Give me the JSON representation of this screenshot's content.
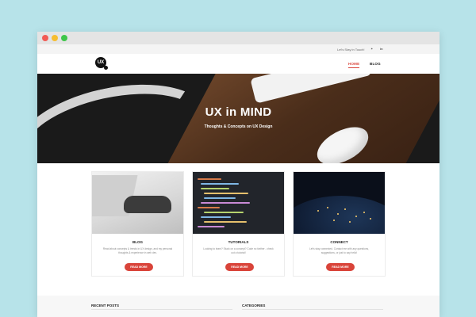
{
  "topbar": {
    "stay_text": "Let's Stay in Touch!",
    "twitter_icon": "twitter-icon",
    "linkedin_icon": "linkedin-icon"
  },
  "header": {
    "logo_text": "UX",
    "nav": [
      {
        "label": "HOME",
        "active": true
      },
      {
        "label": "BLOG",
        "active": false
      }
    ]
  },
  "hero": {
    "title": "UX in MIND",
    "subtitle": "Thoughts & Concepts on UX Design"
  },
  "cards": [
    {
      "title": "BLOG",
      "desc": "Read about concepts & trends in UX design, and my personal thoughts & experience in web dev.",
      "button": "READ MORE"
    },
    {
      "title": "TUTORIALS",
      "desc": "Looking to learn? Stuck on a concept? Code no farther - check out a tutorial!",
      "button": "READ MORE"
    },
    {
      "title": "CONNECT",
      "desc": "Let's stay connected. Contact me with any questions, suggestions, or just to say hello!",
      "button": "READ MORE"
    }
  ],
  "footer_sections": {
    "recent_posts": "RECENT POSTS",
    "categories": "CATEGORIES"
  },
  "colors": {
    "accent": "#d9443a",
    "background": "#b7e3e9"
  }
}
